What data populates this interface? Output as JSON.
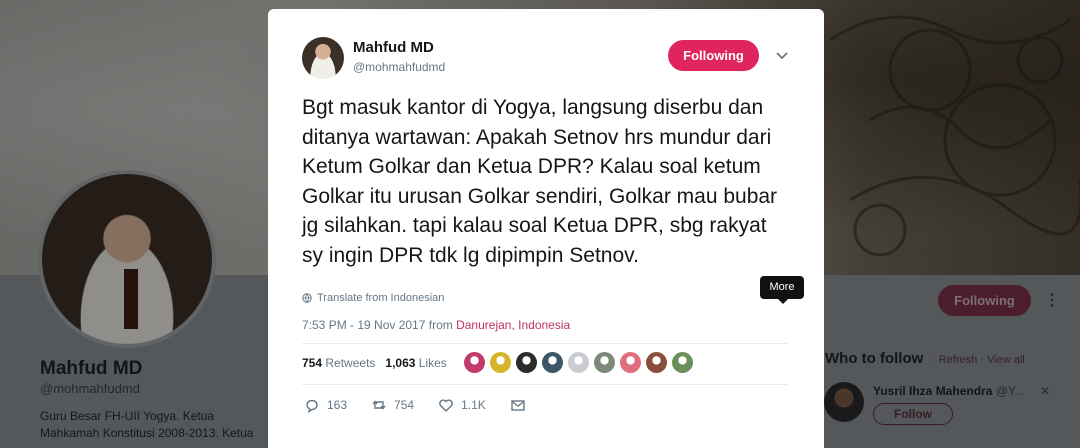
{
  "profile": {
    "name": "Mahfud MD",
    "handle": "@mohmahfudmd",
    "bio": "Guru Besar FH-UII Yogya. Ketua Mahkamah Konstitusi 2008-2013. Ketua",
    "follow_label": "Following"
  },
  "who_to_follow": {
    "title": "Who to follow",
    "refresh": "Refresh",
    "view_all": "View all",
    "suggestion": {
      "name": "Yusril Ihza Mahendra",
      "handle": "@Y...",
      "follow_label": "Follow"
    }
  },
  "tweet": {
    "author_name": "Mahfud MD",
    "author_handle": "@mohmahfudmd",
    "following_label": "Following",
    "text": "Bgt masuk kantor di Yogya, langsung diserbu dan ditanya wartawan: Apakah Setnov hrs mundur dari Ketum Golkar dan Ketua DPR? Kalau soal ketum Golkar itu urusan Golkar sendiri, Golkar mau bubar jg silahkan. tapi kalau soal Ketua DPR, sbg rakyat sy ingin DPR tdk lg dipimpin Setnov.",
    "translate_label": "Translate from Indonesian",
    "time": "7:53 PM - 19 Nov 2017",
    "from_word": "from",
    "location": "Danurejan, Indonesia",
    "tooltip": "More",
    "retweets_count": "754",
    "retweets_label": "Retweets",
    "likes_count": "1,063",
    "likes_label": "Likes",
    "replies": "163",
    "retweet_action": "754",
    "like_action": "1.1K",
    "liker_colors": [
      "#c03a6b",
      "#d6b52c",
      "#2b2b2b",
      "#3d5766",
      "#c8ccd0",
      "#7d8a7a",
      "#e06d7c",
      "#8a4e3e",
      "#6b8f5a"
    ]
  },
  "colors": {
    "accent": "#e0245e",
    "link": "#c0345e"
  }
}
